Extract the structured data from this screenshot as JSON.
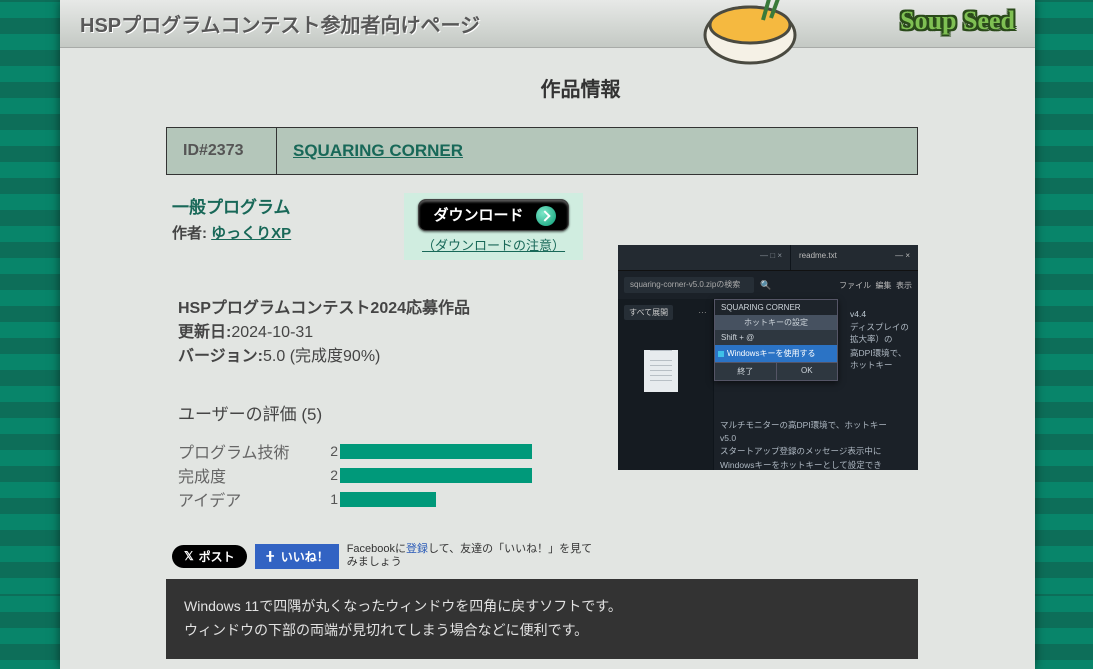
{
  "header": {
    "page_title": "HSPプログラムコンテスト参加者向けページ",
    "logo_text": "Soup Seed"
  },
  "section_title": "作品情報",
  "entry": {
    "id_label": "ID#2373",
    "title": "SQUARING CORNER",
    "category": "一般プログラム",
    "author_label": "作者: ",
    "author_name": "ゆっくりXP"
  },
  "download": {
    "button": "ダウンロード",
    "note": "（ダウンロードの注意）"
  },
  "meta": {
    "contest_line": "HSPプログラムコンテスト2024応募作品",
    "updated_label": "更新日:",
    "updated_value": "2024-10-31",
    "version_label": "バージョン:",
    "version_value": "5.0 (完成度90%)"
  },
  "ratings": {
    "title": "ユーザーの評価 (5)",
    "items": [
      {
        "label": "プログラム技術",
        "value": "2",
        "width": 192
      },
      {
        "label": "完成度",
        "value": "2",
        "width": 192
      },
      {
        "label": "アイデア",
        "value": "1",
        "width": 96
      }
    ]
  },
  "social": {
    "x_post": "ポスト",
    "fb_like": "いいね！",
    "fb_text_pre": "Facebookに",
    "fb_link": "登録",
    "fb_text_post": "して、友達の「いいね！」を見てみましょう"
  },
  "description": {
    "line1": "Windows 11で四隅が丸くなったウィンドウを四角に戻すソフトです。",
    "line2": "ウィンドウの下部の両端が見切れてしまう場合などに便利です。"
  },
  "screenshot": {
    "readme": "readme.txt",
    "win_minmaxclose": "— □ ×",
    "menu": {
      "file": "ファイル",
      "edit": "編集",
      "view": "表示"
    },
    "search_placeholder": "squaring-corner-v5.0.zipの検索",
    "tab_all": "すべて展開",
    "v44": "v4.4",
    "popup": {
      "parent": "SQUARING CORNER",
      "title": "ホットキーの設定",
      "row1": "Shift + @",
      "row2": "Windowsキーを使用する",
      "btn_exit": "終了",
      "btn_ok": "OK"
    },
    "notes": {
      "l1": "ディスプレイの拡大率）の",
      "l2": "高DPI環境で、ホットキー",
      "l3": "マルチモニターの高DPI環境で、ホットキー",
      "l4": "v5.0",
      "l5": "スタートアップ登録のメッセージ表示中に",
      "l6": "Windowsキーをホットキーとして設定でき"
    }
  }
}
